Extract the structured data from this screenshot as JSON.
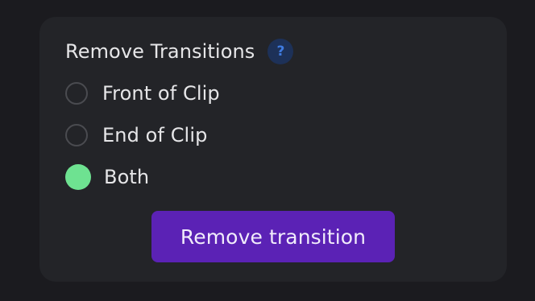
{
  "panel": {
    "title": "Remove Transitions",
    "help_icon": {
      "name": "help-icon",
      "glyph": "?"
    },
    "options": [
      {
        "label": "Front of Clip",
        "checked": false
      },
      {
        "label": "End of Clip",
        "checked": false
      },
      {
        "label": "Both",
        "checked": true
      }
    ],
    "button_label": "Remove transition"
  },
  "colors": {
    "background": "#1b1b1f",
    "panel": "#232428",
    "radio_checked": "#6ee291",
    "button": "#5b22b5",
    "help_icon_bg": "#1d3158",
    "help_icon_fg": "#3f7be0"
  }
}
